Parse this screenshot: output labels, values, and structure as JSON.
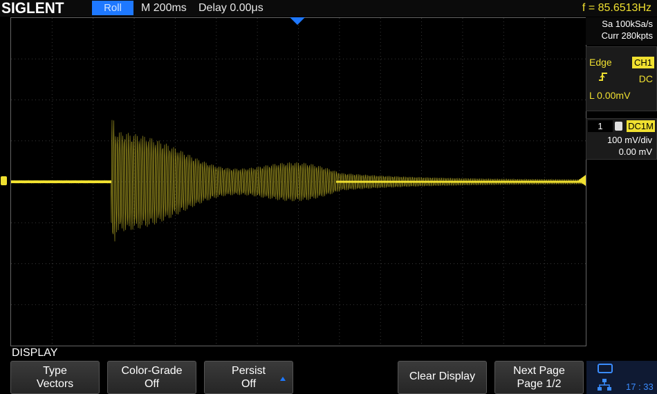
{
  "header": {
    "brand": "SIGLENT",
    "mode": "Roll",
    "timebase": "M 200ms",
    "delay": "Delay 0.00μs",
    "frequency": "f = 85.6513Hz"
  },
  "acquisition": {
    "sample_rate": "Sa 100kSa/s",
    "memory_depth": "Curr 280kpts"
  },
  "trigger": {
    "type": "Edge",
    "source": "CH1",
    "coupling": "DC",
    "level": "L  0.00mV",
    "slope_icon": "rising-edge-icon"
  },
  "channel": {
    "number": "1",
    "coupling": "DC1M",
    "scale": "100 mV/div",
    "offset": "0.00 mV",
    "color": "#f0e030"
  },
  "menu": {
    "title": "DISPLAY",
    "softkeys": [
      {
        "line1": "Type",
        "line2": "Vectors"
      },
      {
        "line1": "Color-Grade",
        "line2": "Off"
      },
      {
        "line1": "Persist",
        "line2": "Off"
      },
      {
        "line1": "Clear Display"
      },
      {
        "line1": "Next Page",
        "line2": "Page 1/2"
      }
    ]
  },
  "status": {
    "time": "17 : 33",
    "usb_icon": "usb-icon",
    "network_icon": "network-icon"
  },
  "colors": {
    "accent": "#1e78ff",
    "trace": "#f0e030"
  }
}
